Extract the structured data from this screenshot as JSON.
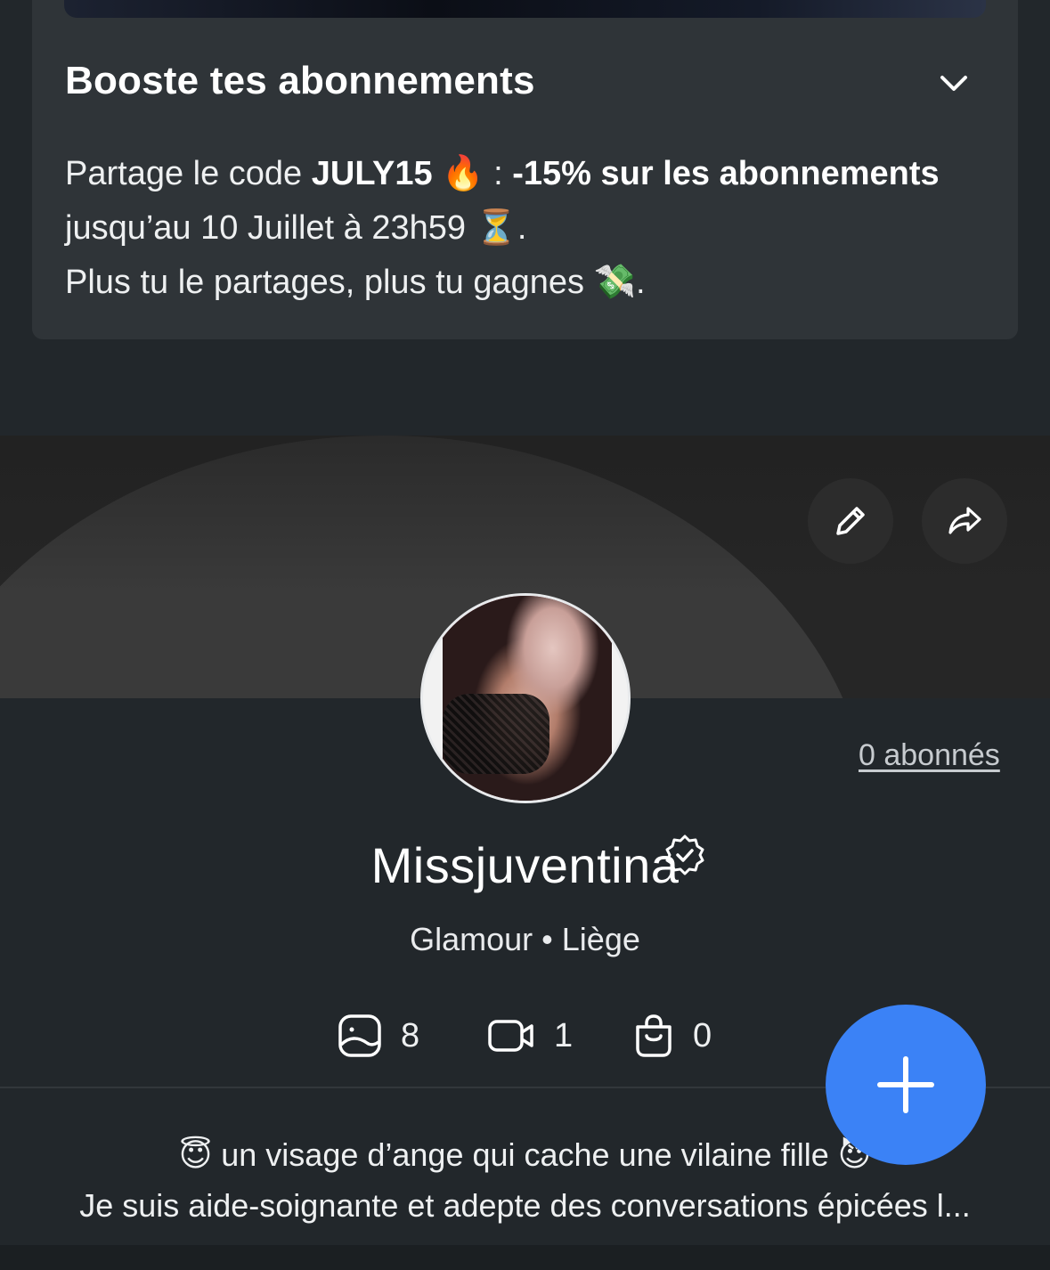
{
  "boost": {
    "title": "Booste tes abonnements",
    "text_prefix": "Partage le code ",
    "code": "JULY15",
    "fire_emoji": "🔥",
    "colon": " : ",
    "discount": "-15% sur les abonnements",
    "deadline": "jusqu’au 10 Juillet à 23h59 ",
    "hourglass_emoji": "⏳",
    "period": ".",
    "line3": "Plus tu le partages, plus tu gagnes ",
    "money_emoji": "💸",
    "line3_end": "."
  },
  "profile": {
    "followers": "0 abonnés",
    "name": "Missjuventina",
    "meta": "Glamour • Liège",
    "stats": {
      "posts": "8",
      "videos": "1",
      "shop": "0"
    },
    "bio_line1_emoji": "😇",
    "bio_line1": " un visage d’ange qui cache une vilaine fille ",
    "bio_line1_end_emoji": "😈",
    "bio_line2": "Je suis aide-soignante et adepte des conversations épicées l..."
  },
  "colors": {
    "background": "#22272b",
    "card": "#2f3438",
    "accent": "#3b82f6"
  },
  "icons": [
    "chevron-down-icon",
    "pencil-icon",
    "share-icon",
    "verified-badge-icon",
    "photo-icon",
    "video-icon",
    "shopping-bag-icon",
    "plus-icon"
  ]
}
